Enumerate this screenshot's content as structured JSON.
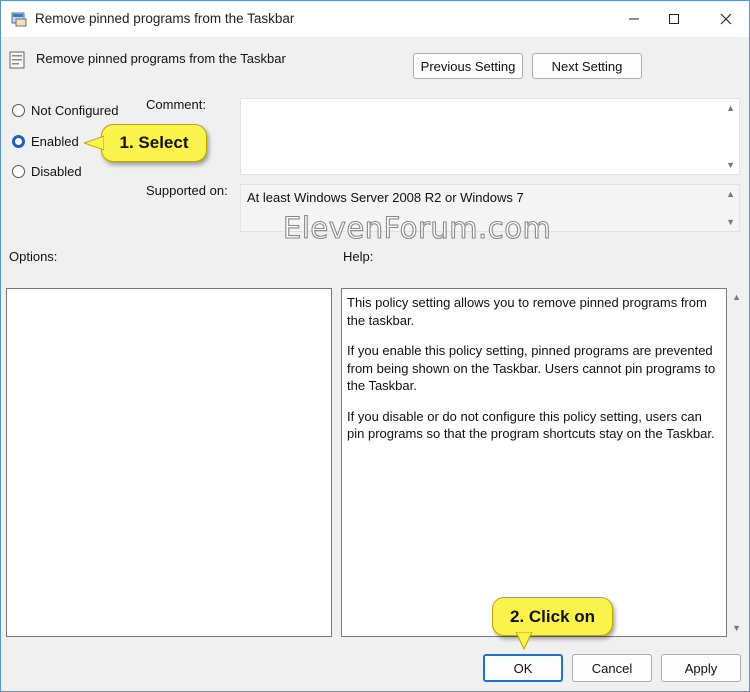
{
  "window": {
    "title": "Remove pinned programs from the Taskbar"
  },
  "header": {
    "title": "Remove pinned programs from the Taskbar"
  },
  "nav": {
    "previous": "Previous Setting",
    "next": "Next Setting"
  },
  "state": {
    "options": [
      "Not Configured",
      "Enabled",
      "Disabled"
    ],
    "selected": "Enabled"
  },
  "labels": {
    "comment": "Comment:",
    "supported_on": "Supported on:",
    "options": "Options:",
    "help": "Help:"
  },
  "supported_on_value": "At least Windows Server 2008 R2 or Windows 7",
  "comment_value": "",
  "help_text": [
    "This policy setting allows you to remove pinned programs from the taskbar.",
    "If you enable this policy setting, pinned programs are prevented from being shown on the Taskbar. Users cannot pin programs to the Taskbar.",
    "If you disable or do not configure this policy setting, users can pin programs so that the program shortcuts stay on the Taskbar."
  ],
  "buttons": {
    "ok": "OK",
    "cancel": "Cancel",
    "apply": "Apply"
  },
  "annotations": {
    "select": "1. Select",
    "click": "2. Click on"
  },
  "watermark": "ElevenForum.com",
  "colors": {
    "accent": "#1f6fcf",
    "callout": "#fbf24c"
  }
}
